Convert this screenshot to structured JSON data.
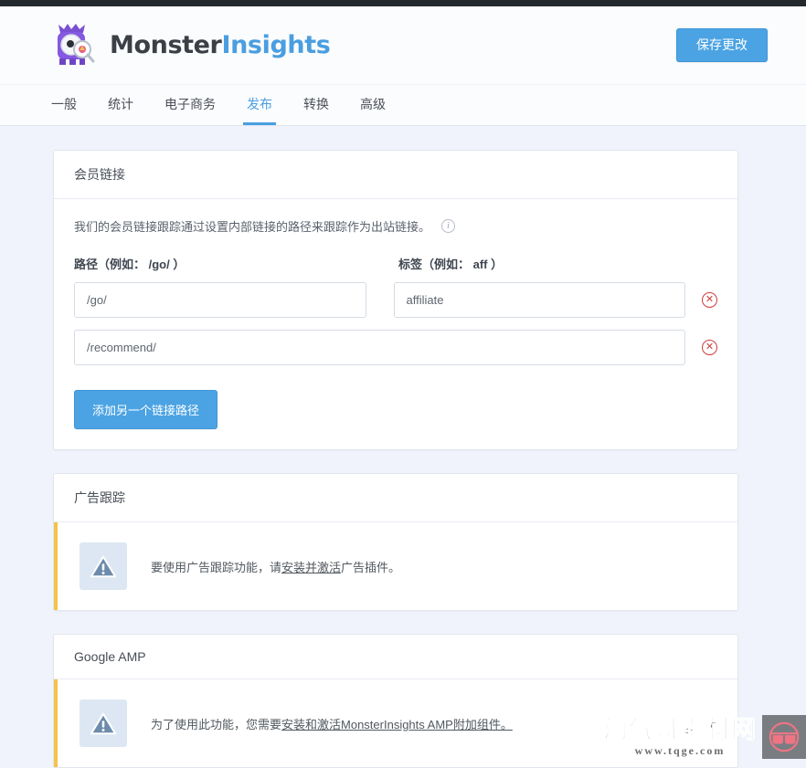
{
  "header": {
    "brand_first": "Monster",
    "brand_second": "Insights",
    "logo_icon": "monster-mascot-icon",
    "save_label": "保存更改"
  },
  "tabs": [
    {
      "label": "一般",
      "active": false
    },
    {
      "label": "统计",
      "active": false
    },
    {
      "label": "电子商务",
      "active": false
    },
    {
      "label": "发布",
      "active": true
    },
    {
      "label": "转换",
      "active": false
    },
    {
      "label": "高级",
      "active": false
    }
  ],
  "affiliate_card": {
    "title": "会员链接",
    "description": "我们的会员链接跟踪通过设置内部链接的路径来跟踪作为出站链接。",
    "info_icon": "info-circle-icon",
    "path_column_label": "路径（例如： /go/ ）",
    "label_column_label": "标签（例如： aff ）",
    "rows": [
      {
        "path_value": "/go/",
        "label_value": "affiliate",
        "remove_icon": "remove-circle-icon"
      },
      {
        "path_value": "/recommend/",
        "label_value": "",
        "remove_icon": "remove-circle-icon"
      }
    ],
    "add_button_label": "添加另一个链接路径"
  },
  "ads_card": {
    "title": "广告跟踪",
    "warn_icon": "warning-triangle-icon",
    "notice_prefix": "要使用广告跟踪功能，请",
    "notice_link": "安装并激活",
    "notice_suffix": "广告插件。"
  },
  "amp_card": {
    "title": "Google AMP",
    "warn_icon": "warning-triangle-icon",
    "notice_prefix": "为了使用此功能，您需要",
    "notice_link": "安装和激活MonsterInsights AMP附加组件。",
    "notice_suffix": ""
  },
  "watermark": {
    "cn_text": "淘气哥素材网",
    "url_text": "www.tqge.com",
    "logo_icon": "sunglasses-logo-icon"
  },
  "colors": {
    "accent_blue": "#4ba3e3",
    "brand_dark": "#3b3f46",
    "warn_border": "#f5c24a",
    "remove_red": "#cf3c3c",
    "page_bg": "#f0f3fb"
  }
}
